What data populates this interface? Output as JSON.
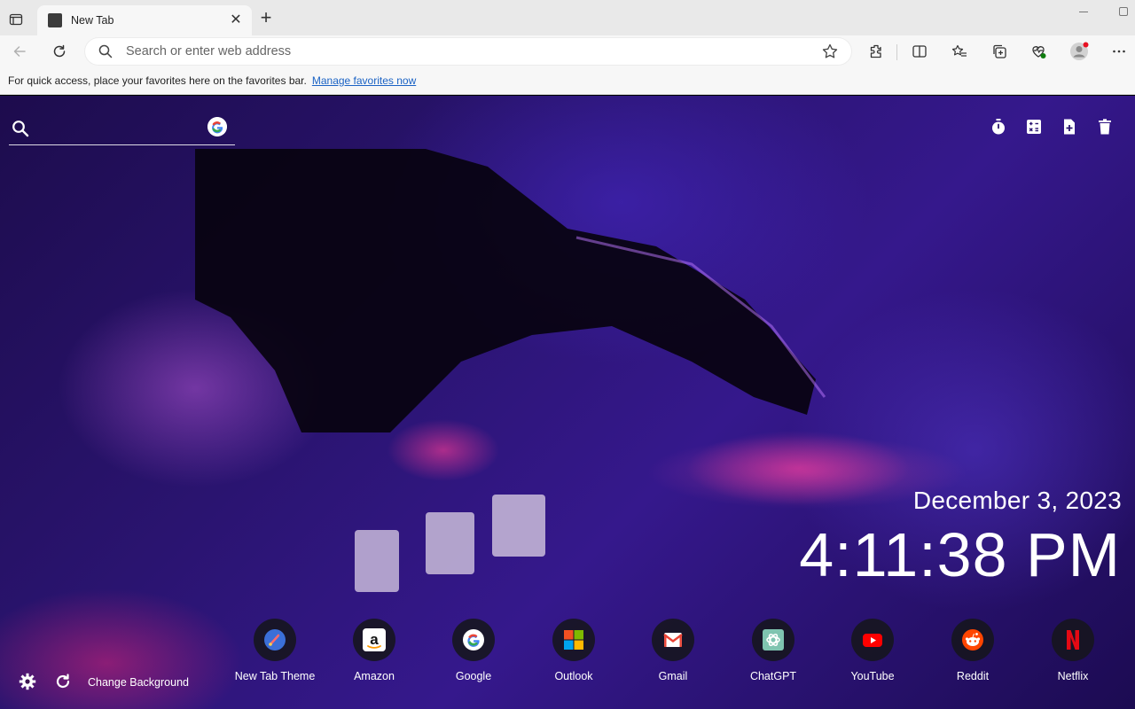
{
  "browser": {
    "tab": {
      "title": "New Tab",
      "close_glyph": "✕"
    },
    "new_tab_glyph": "+",
    "address_bar": {
      "placeholder": "Search or enter web address",
      "value": ""
    },
    "favorites_bar": {
      "message": "For quick access, place your favorites here on the favorites bar.",
      "link": "Manage favorites now"
    },
    "toolbar_icons": [
      "back-icon",
      "refresh-icon",
      "favorite-star-icon",
      "extensions-icon",
      "split-screen-icon",
      "favorites-icon",
      "collections-icon",
      "browser-essentials-icon",
      "profile-icon",
      "more-icon"
    ]
  },
  "page": {
    "search": {
      "value": "",
      "engine_icon": "google-icon"
    },
    "tools": [
      "timer-icon",
      "calculator-icon",
      "new-note-icon",
      "trash-icon"
    ],
    "date": "December 3, 2023",
    "time": "4:11:38 PM",
    "shortcuts": [
      {
        "label": "New Tab Theme",
        "icon": "new-tab-theme-icon"
      },
      {
        "label": "Amazon",
        "icon": "amazon-icon"
      },
      {
        "label": "Google",
        "icon": "google-icon"
      },
      {
        "label": "Outlook",
        "icon": "outlook-icon"
      },
      {
        "label": "Gmail",
        "icon": "gmail-icon"
      },
      {
        "label": "ChatGPT",
        "icon": "chatgpt-icon"
      },
      {
        "label": "YouTube",
        "icon": "youtube-icon"
      },
      {
        "label": "Reddit",
        "icon": "reddit-icon"
      },
      {
        "label": "Netflix",
        "icon": "netflix-icon"
      }
    ],
    "change_background": "Change Background"
  },
  "colors": {
    "link": "#1a62c4",
    "profile_badge": "#e81123",
    "essentials_badge": "#107c10",
    "youtube": "#ff0000",
    "netflix": "#e50914",
    "reddit": "#ff4500"
  }
}
